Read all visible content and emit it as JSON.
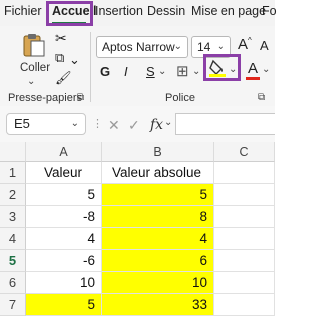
{
  "menu": {
    "items": [
      "Fichier",
      "Accueil",
      "Insertion",
      "Dessin",
      "Mise en page",
      "Fo"
    ],
    "active": "Accueil"
  },
  "ribbon": {
    "clipboard": {
      "paste_label": "Coller",
      "group_label": "Presse-papiers"
    },
    "font": {
      "font_name": "Aptos Narrow",
      "font_size": "14",
      "bold": "G",
      "italic": "I",
      "underline": "S",
      "font_color_glyph": "A",
      "group_label": "Police",
      "font_color_bar": "#e0261b",
      "fill_color_bar": "#ffff00"
    }
  },
  "formula_bar": {
    "name_box": "E5",
    "formula": ""
  },
  "sheet": {
    "columns": [
      "A",
      "B",
      "C"
    ],
    "rows": [
      {
        "num": "1",
        "a": "Valeur",
        "b": "Valeur absolue"
      },
      {
        "num": "2",
        "a": "5",
        "b": "5"
      },
      {
        "num": "3",
        "a": "-8",
        "b": "8"
      },
      {
        "num": "4",
        "a": "4",
        "b": "4"
      },
      {
        "num": "5",
        "a": "-6",
        "b": "6"
      },
      {
        "num": "6",
        "a": "10",
        "b": "10"
      },
      {
        "num": "7",
        "a": "5",
        "b": "33"
      }
    ],
    "highlight_color": "#ffff00"
  }
}
